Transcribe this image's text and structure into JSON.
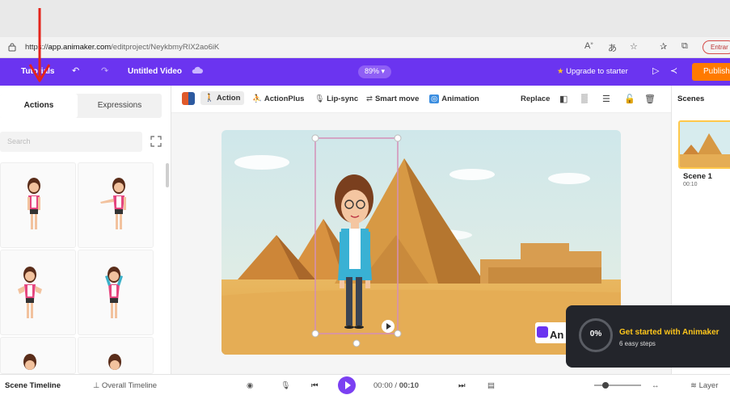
{
  "browser": {
    "url_host": "app.animaker.com",
    "url_scheme": "https://",
    "url_path": "/editproject/NeykbmyRIX2ao6iK",
    "entrar_label": "Entrar"
  },
  "appbar": {
    "tutorial_label": "Tutorials",
    "project_title": "Untitled Video",
    "zoom_level": "89%",
    "upgrade_label": "Upgrade to starter",
    "publish_label": "Publish"
  },
  "left_panel": {
    "tabs": [
      {
        "label": "Actions",
        "active": true
      },
      {
        "label": "Expressions",
        "active": false
      }
    ],
    "search_placeholder": "Search"
  },
  "toolbar": {
    "action": "Action",
    "actionplus": "ActionPlus",
    "lipsync": "Lip-sync",
    "smartmove": "Smart move",
    "animation": "Animation",
    "replace": "Replace"
  },
  "scenes": {
    "title": "Scenes",
    "items": [
      {
        "name": "Scene 1",
        "duration": "00:10"
      }
    ]
  },
  "bottom": {
    "scene_timeline": "Scene Timeline",
    "overall_timeline": "Overall Timeline",
    "time_current": "00:00",
    "time_separator": " / ",
    "time_total": "00:10",
    "layer_label": "Layer"
  },
  "toast": {
    "percent": "0%",
    "title": "Get started with Animaker",
    "subtitle": "6 easy steps"
  },
  "colors": {
    "brand_purple": "#6b34f0",
    "publish_orange": "#ff7a00",
    "annotation_red": "#e3241b"
  }
}
